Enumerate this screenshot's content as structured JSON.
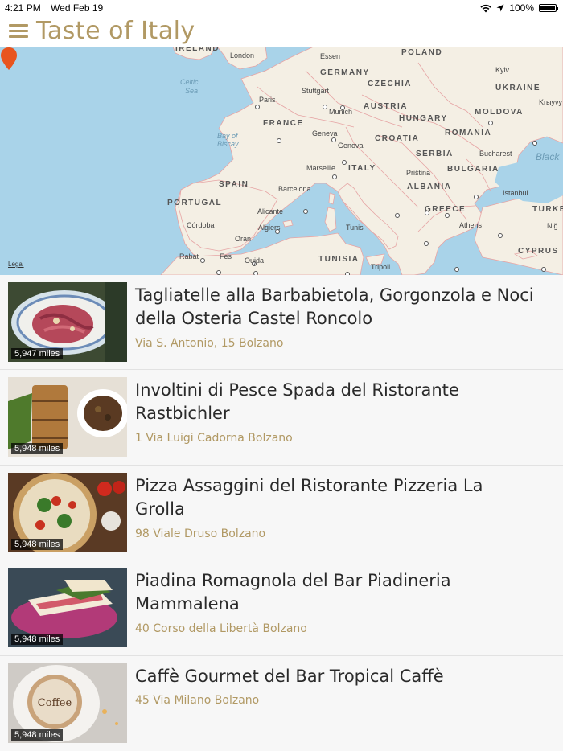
{
  "status": {
    "time": "4:21 PM",
    "date": "Wed Feb 19",
    "battery": "100%"
  },
  "header": {
    "title": "Taste of Italy"
  },
  "map": {
    "legal": "Legal",
    "countries": [
      "IRELAND",
      "POLAND",
      "GERMANY",
      "CZECHIA",
      "UKRAINE",
      "AUSTRIA",
      "MOLDOVA",
      "FRANCE",
      "HUNGARY",
      "ROMANIA",
      "CROATIA",
      "SERBIA",
      "BULGARIA",
      "ITALY",
      "SPAIN",
      "ALBANIA",
      "PORTUGAL",
      "GREECE",
      "TURKE",
      "TUNISIA",
      "CYPRUS"
    ],
    "cities": [
      "London",
      "Essen",
      "Kyiv",
      "Paris",
      "Stuttgart",
      "Krыyvy",
      "Munich",
      "Geneva",
      "Genova",
      "Bucharest",
      "Marseille",
      "Priština",
      "Barcelona",
      "Istanbul",
      "Alicante",
      "Córdoba",
      "Algiers",
      "Tunis",
      "Athens",
      "Niğ",
      "Oran",
      "Rabat",
      "Fes",
      "Oujda",
      "Tripoli"
    ],
    "seas": [
      "Celtic",
      "Sea",
      "Bay of",
      "Biscay",
      "Black"
    ]
  },
  "restaurants": [
    {
      "title": "Tagliatelle alla Barbabietola, Gorgonzola e Noci della Osteria Castel Roncolo",
      "address": "Via S. Antonio, 15 Bolzano",
      "distance": "5,947 miles"
    },
    {
      "title": "Involtini di Pesce Spada del Ristorante Rastbichler",
      "address": "1 Via Luigi Cadorna Bolzano",
      "distance": "5,948 miles"
    },
    {
      "title": "Pizza Assaggini del Ristorante Pizzeria La Grolla",
      "address": "98 Viale Druso Bolzano",
      "distance": "5,948 miles"
    },
    {
      "title": "Piadina Romagnola del Bar Piadineria Mammalena",
      "address": "40 Corso della Libertà Bolzano",
      "distance": "5,948 miles"
    },
    {
      "title": "Caffè Gourmet del Bar Tropical Caffè",
      "address": "45 Via Milano Bolzano",
      "distance": "5,948 miles"
    }
  ],
  "colors": {
    "accent": "#b19964",
    "pin": "#e8541e",
    "land": "#f4efe4",
    "water": "#a9d3e9"
  }
}
